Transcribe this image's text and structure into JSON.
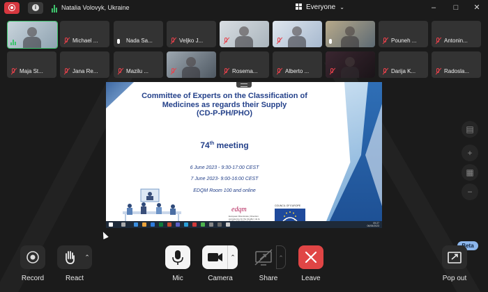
{
  "topbar": {
    "speaker": "Natalia Volovyk, Ukraine",
    "view_selector": "Everyone",
    "icons": [
      "record-icon",
      "info-icon",
      "speaking-icon",
      "grid-icon",
      "minimize-icon",
      "maximize-icon",
      "close-icon"
    ]
  },
  "participants": [
    {
      "name": "",
      "state": "speaking",
      "video": true
    },
    {
      "name": "Michael ...",
      "state": "muted",
      "video": false
    },
    {
      "name": "Nada Sa...",
      "state": "unmuted",
      "video": false
    },
    {
      "name": "Veljko J...",
      "state": "muted",
      "video": false
    },
    {
      "name": "",
      "state": "muted",
      "video": true
    },
    {
      "name": "",
      "state": "muted",
      "video": true
    },
    {
      "name": "",
      "state": "unmuted",
      "video": true
    },
    {
      "name": "Pouneh ...",
      "state": "muted",
      "video": false
    },
    {
      "name": "Antonin...",
      "state": "muted",
      "video": false
    },
    {
      "name": "Maja St...",
      "state": "muted",
      "video": false
    },
    {
      "name": "Jana Re...",
      "state": "muted",
      "video": false
    },
    {
      "name": "Mazilu ...",
      "state": "muted",
      "video": false
    },
    {
      "name": "",
      "state": "muted",
      "video": true
    },
    {
      "name": "Rosema...",
      "state": "muted",
      "video": false
    },
    {
      "name": "Alberto ...",
      "state": "muted",
      "video": false
    },
    {
      "name": "",
      "state": "muted",
      "video": true
    },
    {
      "name": "Darija K...",
      "state": "muted",
      "video": false
    },
    {
      "name": "Radosla...",
      "state": "muted",
      "video": false
    }
  ],
  "slide": {
    "title_line1": "Committee of Experts on the Classification of",
    "title_line2": "Medicines as regards their Supply",
    "title_line3": "(CD-P-PH/PHO)",
    "meeting_number": "74",
    "meeting_sup": "th",
    "meeting_word": "meeting",
    "date1": "6 June 2023 - 9:30-17:00 CEST",
    "date2": "7 June 2023- 9:00-16:00 CEST",
    "venue": "EDQM Room 100 and online",
    "edqm_logo": "edqm",
    "edqm_tagline": "European Directorate | Direction européenne for the Quality | de la qualité of Medicines | du médicament",
    "coe_label": "COUNCIL OF EUROPE",
    "taskbar_time": "09:27",
    "taskbar_date": "06/06/2023"
  },
  "side_controls": [
    "chat-icon",
    "zoom-in-icon",
    "fit-icon",
    "zoom-out-icon"
  ],
  "controls": {
    "record": "Record",
    "react": "React",
    "mic": "Mic",
    "camera": "Camera",
    "share": "Share",
    "leave": "Leave",
    "popout": "Pop out",
    "beta": "Beta"
  },
  "colors": {
    "record_red": "#d7373f",
    "leave_red": "#e04545",
    "mute_red": "#e8414b",
    "speaking_green": "#3ec46d",
    "slide_title_blue": "#24418a",
    "beta_blue": "#8cb6ec"
  }
}
